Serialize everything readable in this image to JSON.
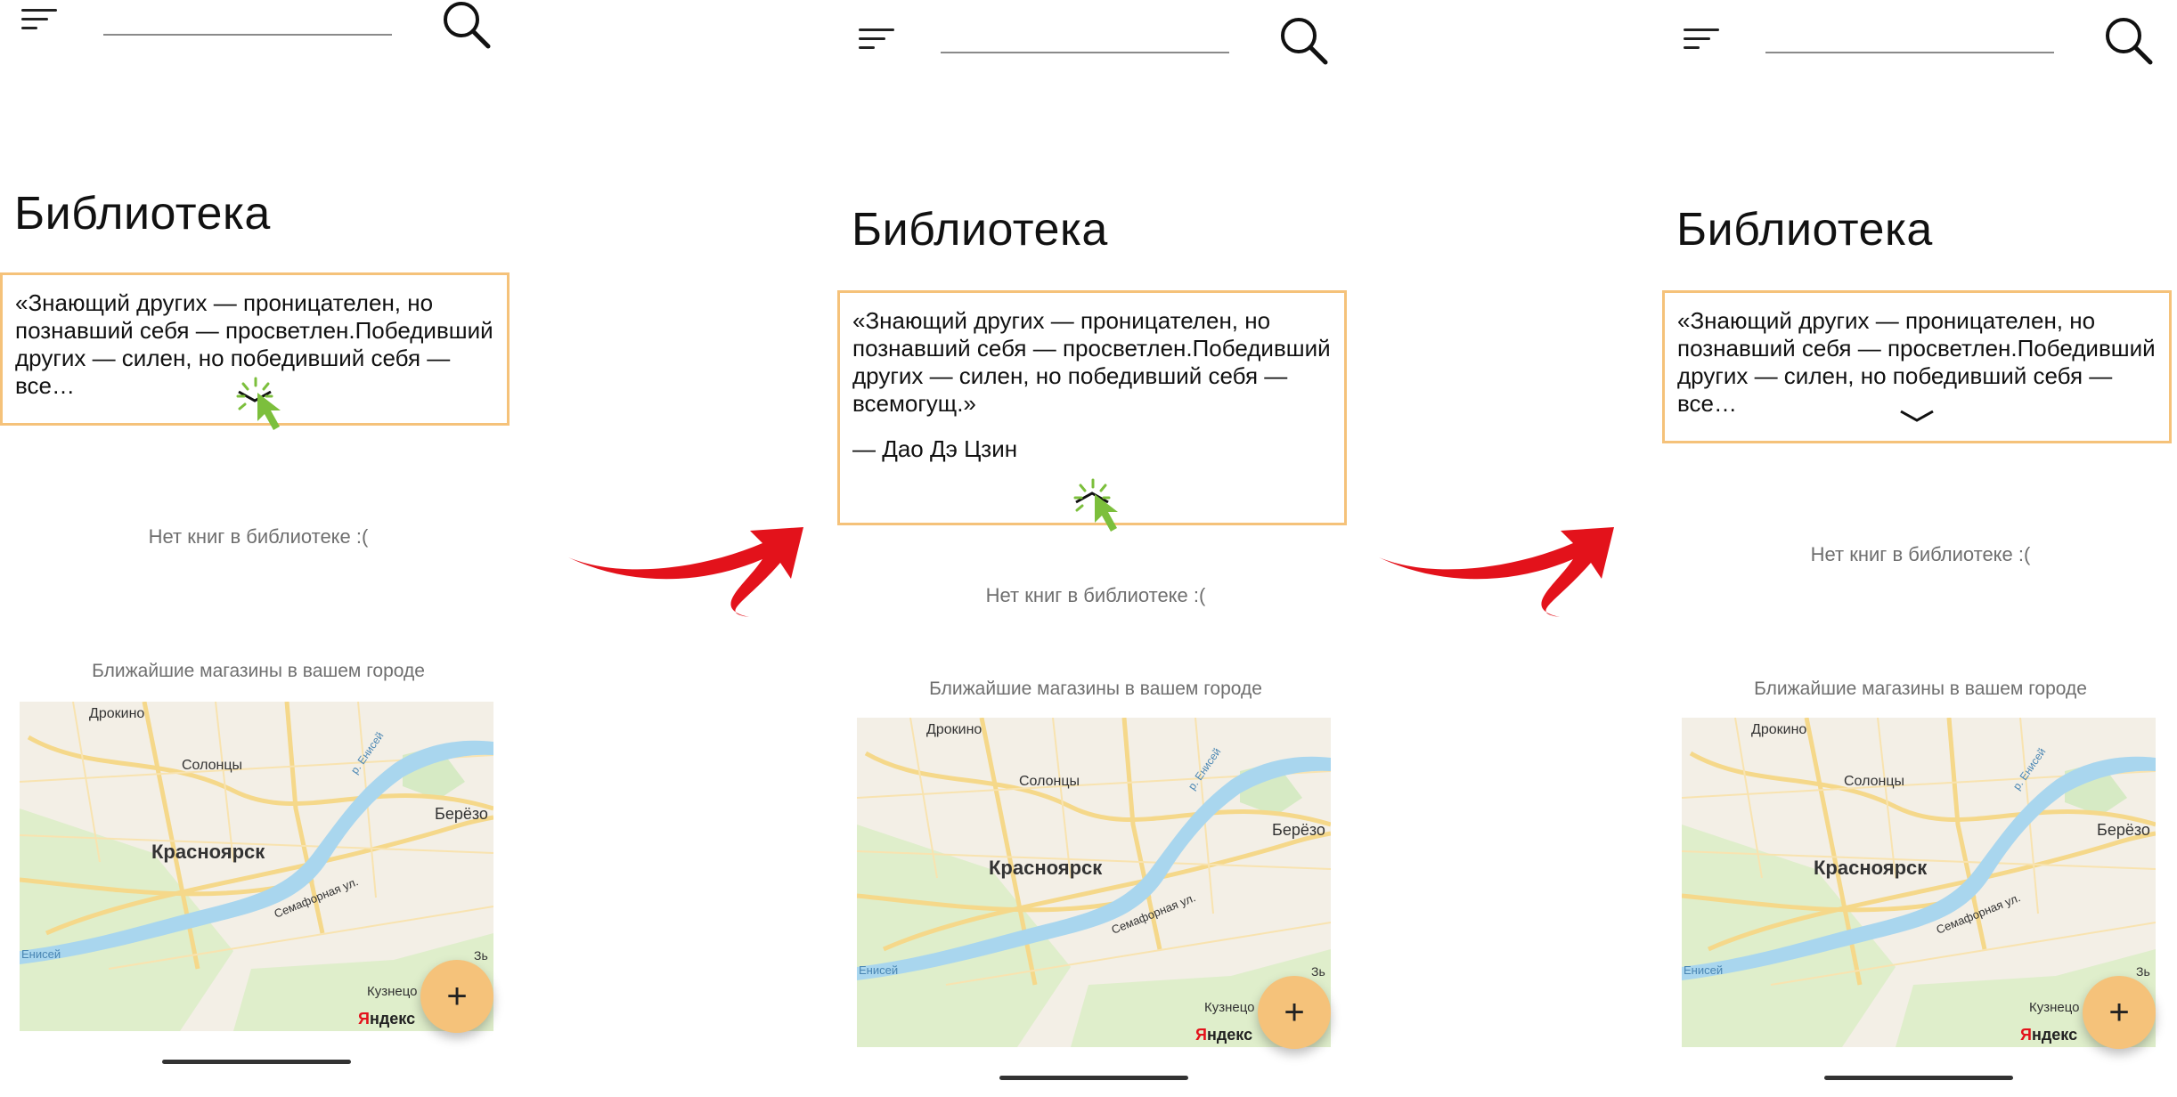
{
  "colors": {
    "accent": "#f5c27a",
    "cursor_green": "#7cbf3c",
    "arrow_red": "#e3121b",
    "muted_text": "#6f6f6f"
  },
  "icons": {
    "menu": "menu-icon",
    "search": "search-icon",
    "chevron_down": "chevron-down-icon",
    "chevron_up": "chevron-up-icon",
    "cursor": "click-cursor-icon",
    "add": "plus-icon"
  },
  "page": {
    "title": "Библиотека",
    "quote_short": "«Знающий других — проницателен, но познавший себя — просветлен.Победивший других — силен, но победивший себя — все…",
    "quote_full": "«Знающий других — проницателен, но познавший себя — просветлен.Победивший других — силен, но победивший себя — всемогущ.»",
    "quote_author": "— Дао Дэ Цзин",
    "empty_library": "Нет книг в библиотеке :(",
    "stores_heading": "Ближайшие магазины в вашем городе",
    "fab_label": "+"
  },
  "map": {
    "places": [
      "Дрокино",
      "Солонцы",
      "Красноярск",
      "Берёзо",
      "Семафорная ул.",
      "р. Енисей",
      "Енисей",
      "Кузнецо",
      "Зь"
    ],
    "brand": "Яндекс"
  },
  "screens": [
    {
      "state": "collapsed",
      "action": "tap chevron to expand"
    },
    {
      "state": "expanded",
      "action": "tap chevron to collapse"
    },
    {
      "state": "collapsed",
      "action": "result"
    }
  ]
}
